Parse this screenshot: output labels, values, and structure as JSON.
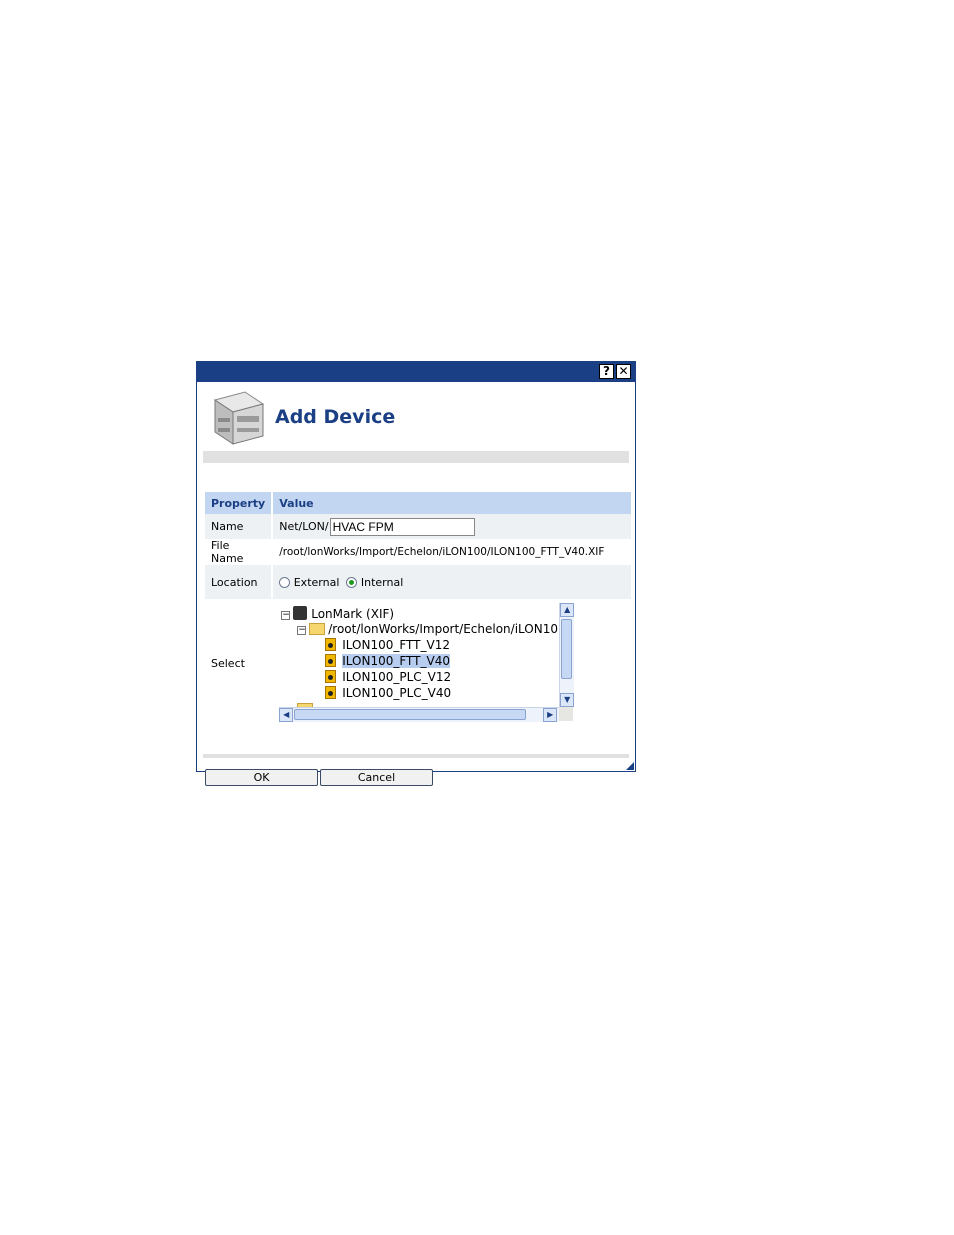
{
  "dialog": {
    "title": "Add Device",
    "help_glyph": "?",
    "close_glyph": "✕",
    "icon": "device-module-icon"
  },
  "table": {
    "header_property": "Property",
    "header_value": "Value",
    "name_label": "Name",
    "name_prefix": "Net/LON/",
    "name_value": "HVAC FPM",
    "filename_label": "File Name",
    "filename_value": "/root/lonWorks/Import/Echelon/iLON100/ILON100_FTT_V40.XIF",
    "location_label": "Location",
    "location_external": "External",
    "location_internal": "Internal",
    "location_selected": "Internal",
    "select_label": "Select"
  },
  "tree": {
    "root": "LonMark (XIF)",
    "folder": "/root/lonWorks/Import/Echelon/iLON10",
    "items": [
      "ILON100_FTT_V12",
      "ILON100_FTT_V40",
      "ILON100_PLC_V12",
      "ILON100_PLC_V40"
    ],
    "selected": "ILON100_FTT_V40",
    "collapse_glyph": "−"
  },
  "buttons": {
    "ok": "OK",
    "cancel": "Cancel"
  },
  "colors": {
    "titlebar": "#1b3f84",
    "header_bg": "#c3d6f1",
    "selection": "#b7cdf0",
    "radio_dot": "#1d9a1d"
  }
}
